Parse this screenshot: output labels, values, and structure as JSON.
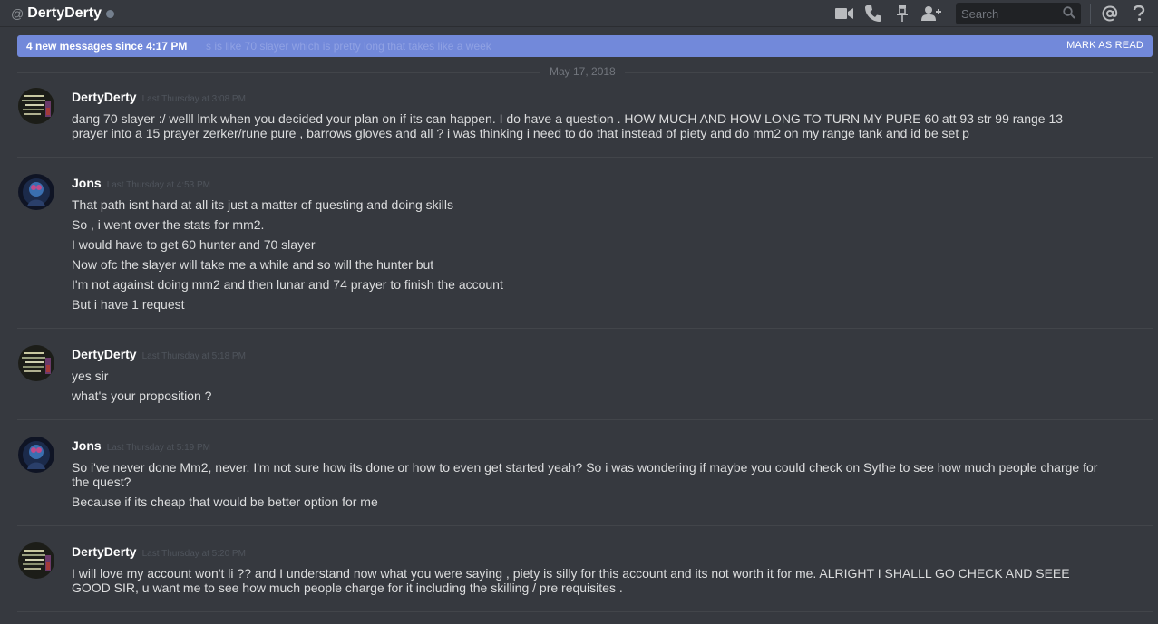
{
  "header": {
    "at_symbol": "@",
    "channel_name": "DertyDerty",
    "search_placeholder": "Search",
    "icons": [
      "video-call-icon",
      "phone-call-icon",
      "pin-icon",
      "add-friend-icon",
      "search-icon",
      "mention-icon",
      "help-icon"
    ]
  },
  "new_messages_bar": {
    "label": "4 new messages since 4:17 PM",
    "ghost_text": "s is like 70 slayer which is pretty long that takes like a week",
    "action": "MARK AS READ"
  },
  "date_divider": "May 17, 2018",
  "messages": [
    {
      "author": "DertyDerty",
      "timestamp": "Last Thursday at 3:08 PM",
      "lines": [
        "dang 70 slayer :/ welll lmk when you decided your plan on if its can happen. I do have a question . HOW MUCH AND HOW LONG TO TURN MY PURE 60 att 93 str 99 range 13",
        "prayer into a 15 prayer zerker/rune pure , barrows gloves and all ? i was thinking i need to do that instead of piety and do mm2 on my range tank and id be set p"
      ]
    },
    {
      "author": "Jons",
      "timestamp": "Last Thursday at 4:53 PM",
      "lines": [
        "That path isnt hard at all its just a matter of questing and doing skills",
        "So , i went over the stats for mm2.",
        "I would have to get 60 hunter and 70 slayer",
        "Now ofc the slayer will take me a while and so will the hunter but",
        "I'm not against doing mm2 and then lunar and 74 prayer to finish the account",
        "But i have 1 request"
      ]
    },
    {
      "author": "DertyDerty",
      "timestamp": "Last Thursday at 5:18 PM",
      "lines": [
        "yes sir",
        "what's your proposition ?"
      ]
    },
    {
      "author": "Jons",
      "timestamp": "Last Thursday at 5:19 PM",
      "lines": [
        "So i've never done Mm2, never. I'm not sure how its done or how to even get started yeah? So i was wondering if maybe you could check on Sythe to see how much people charge for",
        "the quest?",
        "Because if its cheap that would be better option for me"
      ]
    },
    {
      "author": "DertyDerty",
      "timestamp": "Last Thursday at 5:20 PM",
      "lines": [
        "I will love my account won't li ?? and I understand now what you were saying , piety is silly for this account and its not worth it for me. ALRIGHT I SHALLL GO CHECK AND SEEE",
        "GOOD SIR, u want me to see how much people charge for it including the skilling / pre requisites ."
      ]
    }
  ],
  "colors": {
    "background": "#36393f",
    "accent": "#7289da",
    "username": "#ffffff",
    "message_text": "#dcddde",
    "timestamp": "#4f545c"
  }
}
